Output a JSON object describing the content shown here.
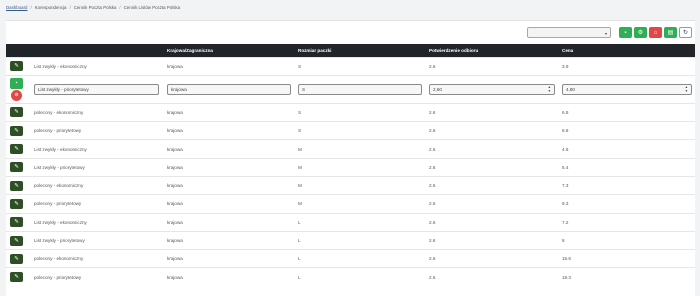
{
  "breadcrumb": {
    "items": [
      "Dashboard",
      "Korespondencja",
      "Cennik Poczta Polska",
      "Cennik Listów Poczta Polska"
    ],
    "separator": "/"
  },
  "toolbar": {
    "select_value": "",
    "buttons": [
      "save-icon",
      "columns-icon",
      "delete-icon",
      "export-icon",
      "refresh-icon"
    ]
  },
  "table": {
    "columns": [
      "",
      "Krajowa/Zagraniczna",
      "Rozmiar paczki",
      "Potwierdzenie odbioru",
      "Cena"
    ],
    "rows": [
      {
        "name": "List zwykły - ekonomiczny",
        "scope": "krajowa",
        "size": "S",
        "confirm": "2.6",
        "price": "3.9"
      },
      {
        "name": "List zwykły - priorytetowy",
        "scope": "krajowa",
        "size": "S",
        "confirm": "2,60",
        "price": "4,80",
        "editing": true
      },
      {
        "name": "polecony - ekonomiczny",
        "scope": "krajowa",
        "size": "S",
        "confirm": "2.6",
        "price": "6.8"
      },
      {
        "name": "polecony - priorytetowy",
        "scope": "krajowa",
        "size": "S",
        "confirm": "2.6",
        "price": "6.8"
      },
      {
        "name": "List zwykły - ekonomiczny",
        "scope": "krajowa",
        "size": "M",
        "confirm": "2.6",
        "price": "4.6"
      },
      {
        "name": "List zwykły - priorytetowy",
        "scope": "krajowa",
        "size": "M",
        "confirm": "2.6",
        "price": "5.4"
      },
      {
        "name": "polecony - ekonomiczny",
        "scope": "krajowa",
        "size": "M",
        "confirm": "2.6",
        "price": "7.3"
      },
      {
        "name": "polecony - priorytetowy",
        "scope": "krajowa",
        "size": "M",
        "confirm": "2.6",
        "price": "9.3"
      },
      {
        "name": "List zwykły - ekonomiczny",
        "scope": "krajowa",
        "size": "L",
        "confirm": "2.6",
        "price": "7.2"
      },
      {
        "name": "List zwykły - priorytetowy",
        "scope": "krajowa",
        "size": "L",
        "confirm": "2.6",
        "price": "8"
      },
      {
        "name": "polecony - ekonomiczny",
        "scope": "krajowa",
        "size": "L",
        "confirm": "2.6",
        "price": "15.6"
      },
      {
        "name": "polecony - priorytetowy",
        "scope": "krajowa",
        "size": "L",
        "confirm": "2.6",
        "price": "18.3"
      }
    ]
  },
  "colors": {
    "header_bg": "#212529",
    "edit_button": "#2e4e26",
    "save_green": "#2fae55",
    "delete_red": "#e04848"
  }
}
